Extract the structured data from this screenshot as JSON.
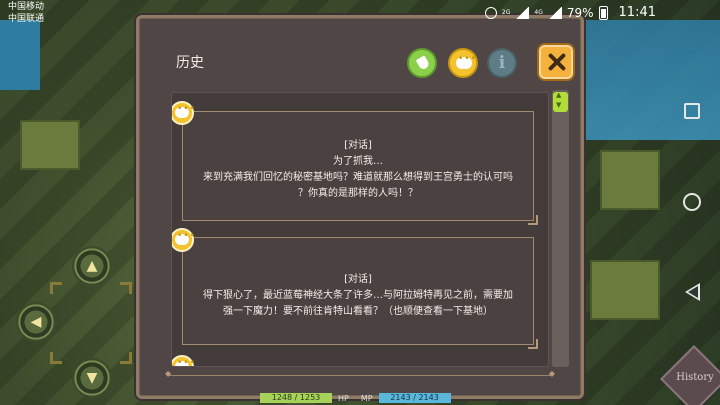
{
  "status_bar": {
    "carrier_1": "中国移动",
    "carrier_2": "中国联通",
    "network_1": "2G",
    "network_2": "4G",
    "battery": "79%",
    "time": "11:41"
  },
  "dialog": {
    "title": "历史",
    "entries": [
      {
        "tag": "[对话]",
        "lines": [
          "为了抓我…",
          "来到充满我们回忆的秘密基地吗？难道就那么想得到王宫勇士的认可吗",
          "？你真的是那样的人吗！？"
        ]
      },
      {
        "tag": "[对话]",
        "lines": [
          "得下狠心了，最近蓝莓神经大条了许多…与阿拉姆特再见之前，需要加",
          "强一下魔力！要不前往肯特山看看？（也顺便查看一下基地）"
        ]
      }
    ],
    "info_glyph": "i"
  },
  "hud": {
    "hp_value": "1248 / 1253",
    "hp_label": "HP",
    "mp_label": "MP",
    "mp_value": "2143 / 2143"
  },
  "history_button": {
    "label": "History"
  },
  "colors": {
    "dialog_bg": "#4f4645",
    "accent_close": "#f4b13c",
    "chat_yellow": "#f3c22c",
    "clear_green": "#8bd04a",
    "scroll_green": "#b2dd3a"
  }
}
